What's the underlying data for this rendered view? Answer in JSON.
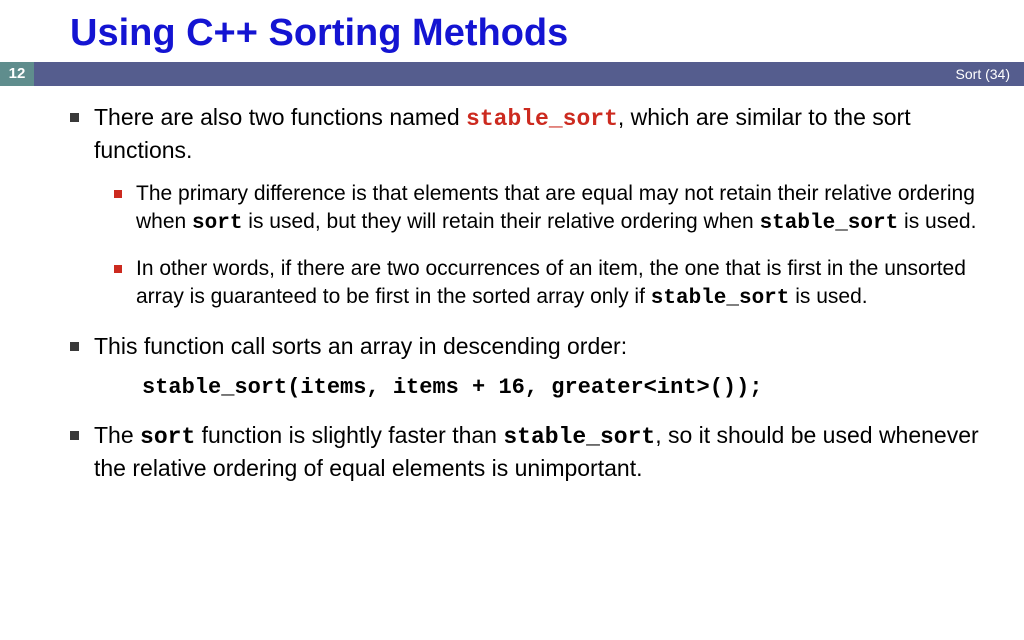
{
  "title": "Using C++ Sorting Methods",
  "page_number": "12",
  "bar_right": "Sort (34)",
  "b1": {
    "pre": "There are also two functions named ",
    "code": "stable_sort",
    "post": ", which are similar to the sort functions."
  },
  "s1": {
    "pre": "The primary difference is that elements that are equal may not retain their relative ordering when ",
    "c1": "sort",
    "mid": " is used, but they will retain their relative ordering when ",
    "c2": "stable_sort",
    "post": " is used."
  },
  "s2": {
    "pre": "In other words, if there are two occurrences of an item, the one that is first in the unsorted array is guaranteed to be first in the sorted array only if ",
    "c1": "stable_sort",
    "post": " is used."
  },
  "b2": "This function call sorts an array in descending order:",
  "code_line": "stable_sort(items, items + 16, greater<int>());",
  "b3": {
    "pre": "The ",
    "c1": "sort",
    "mid": " function is slightly faster than ",
    "c2": "stable_sort",
    "post": ", so it should be used whenever the relative ordering of equal elements is unimportant."
  }
}
